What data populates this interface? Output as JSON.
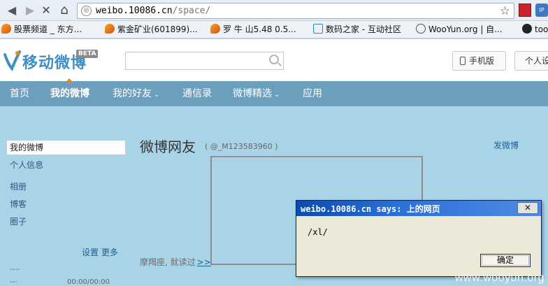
{
  "browser": {
    "url_host": "weibo.10086.cn",
    "url_path": "/space/",
    "bookmarks": [
      {
        "label": "股票频道 _ 东方...",
        "icon": "flame-icon"
      },
      {
        "label": "紫金矿业(601899)...",
        "icon": "flame-icon"
      },
      {
        "label": "罗 牛 山5.48 0.5...",
        "icon": "flame-icon"
      },
      {
        "label": "数码之家 - 互动社区",
        "icon": "home-bookmark-icon"
      },
      {
        "label": "WooYun.org | 自...",
        "icon": "globe-icon"
      },
      {
        "label": "too",
        "icon": "radiation-icon"
      }
    ]
  },
  "header": {
    "logo_text": "移动微博",
    "beta_badge": "BETA",
    "search_placeholder": "",
    "mobile_button": "手机版",
    "personal_button": "个人设"
  },
  "nav": {
    "items": [
      {
        "label": "首页",
        "has_caret": false
      },
      {
        "label": "我的微博",
        "has_caret": false
      },
      {
        "label": "我的好友",
        "has_caret": true
      },
      {
        "label": "通信录",
        "has_caret": false
      },
      {
        "label": "微博精选",
        "has_caret": true
      },
      {
        "label": "应用",
        "has_caret": false
      }
    ],
    "caret": "⌄",
    "accent_color": "#e8891d"
  },
  "sidebar": {
    "items": [
      "我的微博",
      "个人信息",
      "相册",
      "博客",
      "圈子"
    ],
    "settings_link": "设置",
    "more_link": "更多",
    "footer_dash": "----",
    "footer_dash2": "---",
    "footer_time": "00:00/00:00"
  },
  "main": {
    "title": "微博网友",
    "nickname": "( @_M123583960 )",
    "post_link": "发微博",
    "motto": "摩羯座, 就读过",
    "more_arrow": ">>"
  },
  "dialog": {
    "title": "weibo.10086.cn says: 上的网页",
    "close_glyph": "✕",
    "message": "/xl/",
    "ok_button": "确定"
  },
  "watermark": "www.wooyun.org"
}
